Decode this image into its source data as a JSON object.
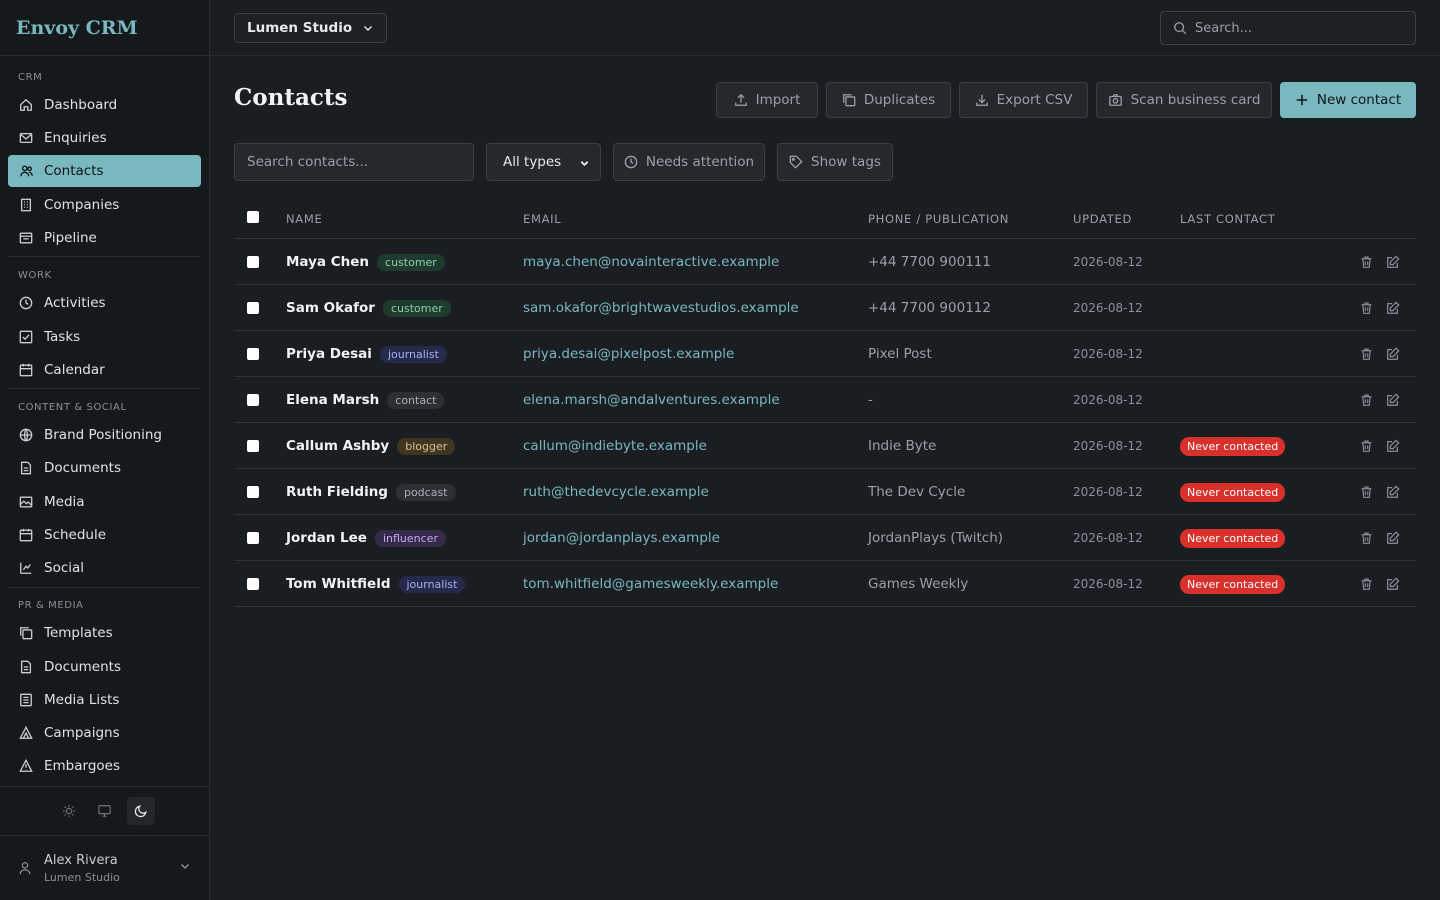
{
  "app": {
    "brand": "Envoy CRM"
  },
  "workspace": {
    "name": "Lumen Studio"
  },
  "top_search": {
    "placeholder": "Search..."
  },
  "sidebar": {
    "sections": [
      {
        "label": "CRM",
        "items": [
          {
            "label": "Dashboard",
            "icon": "home-icon"
          },
          {
            "label": "Enquiries",
            "icon": "mail-icon"
          },
          {
            "label": "Contacts",
            "icon": "users-icon",
            "active": true
          },
          {
            "label": "Companies",
            "icon": "building-icon"
          },
          {
            "label": "Pipeline",
            "icon": "pipeline-icon"
          }
        ]
      },
      {
        "label": "WORK",
        "items": [
          {
            "label": "Activities",
            "icon": "clock-icon"
          },
          {
            "label": "Tasks",
            "icon": "check-square-icon"
          },
          {
            "label": "Calendar",
            "icon": "calendar-icon"
          }
        ]
      },
      {
        "label": "CONTENT & SOCIAL",
        "items": [
          {
            "label": "Brand Positioning",
            "icon": "globe-icon"
          },
          {
            "label": "Documents",
            "icon": "document-icon"
          },
          {
            "label": "Media",
            "icon": "image-icon"
          },
          {
            "label": "Schedule",
            "icon": "calendar-icon"
          },
          {
            "label": "Social",
            "icon": "social-icon"
          }
        ]
      },
      {
        "label": "PR & MEDIA",
        "items": [
          {
            "label": "Templates",
            "icon": "copy-icon"
          },
          {
            "label": "Documents",
            "icon": "document-icon"
          },
          {
            "label": "Media Lists",
            "icon": "list-icon"
          },
          {
            "label": "Campaigns",
            "icon": "triangle-icon"
          },
          {
            "label": "Embargoes",
            "icon": "warning-icon"
          }
        ]
      }
    ],
    "theme": {
      "options": [
        "light",
        "system",
        "dark"
      ],
      "selected": "dark"
    },
    "user": {
      "name": "Alex Rivera",
      "org": "Lumen Studio"
    }
  },
  "main": {
    "title": "Contacts",
    "actions": {
      "import": "Import",
      "duplicates": "Duplicates",
      "export": "Export CSV",
      "scan": "Scan business card",
      "new_contact": "New contact"
    },
    "filters": {
      "search_placeholder": "Search contacts...",
      "type_selected": "All types",
      "needs_attention": "Needs attention",
      "show_tags": "Show tags"
    },
    "table": {
      "headers": {
        "name": "NAME",
        "email": "EMAIL",
        "phone": "PHONE / PUBLICATION",
        "updated": "UPDATED",
        "last_contact": "LAST CONTACT"
      },
      "rows": [
        {
          "name": "Maya Chen",
          "tag": "customer",
          "email": "maya.chen@novainteractive.example",
          "phone": "+44 7700 900111",
          "updated": "2026-08-12",
          "last_contact": ""
        },
        {
          "name": "Sam Okafor",
          "tag": "customer",
          "email": "sam.okafor@brightwavestudios.example",
          "phone": "+44 7700 900112",
          "updated": "2026-08-12",
          "last_contact": ""
        },
        {
          "name": "Priya Desai",
          "tag": "journalist",
          "email": "priya.desai@pixelpost.example",
          "phone": "Pixel Post",
          "updated": "2026-08-12",
          "last_contact": ""
        },
        {
          "name": "Elena Marsh",
          "tag": "contact",
          "email": "elena.marsh@andalventures.example",
          "phone": "-",
          "updated": "2026-08-12",
          "last_contact": ""
        },
        {
          "name": "Callum Ashby",
          "tag": "blogger",
          "email": "callum@indiebyte.example",
          "phone": "Indie Byte",
          "updated": "2026-08-12",
          "last_contact": "Never contacted"
        },
        {
          "name": "Ruth Fielding",
          "tag": "podcast",
          "email": "ruth@thedevcycle.example",
          "phone": "The Dev Cycle",
          "updated": "2026-08-12",
          "last_contact": "Never contacted"
        },
        {
          "name": "Jordan Lee",
          "tag": "influencer",
          "email": "jordan@jordanplays.example",
          "phone": "JordanPlays (Twitch)",
          "updated": "2026-08-12",
          "last_contact": "Never contacted"
        },
        {
          "name": "Tom Whitfield",
          "tag": "journalist",
          "email": "tom.whitfield@gamesweekly.example",
          "phone": "Games Weekly",
          "updated": "2026-08-12",
          "last_contact": "Never contacted"
        }
      ]
    }
  },
  "colors": {
    "accent": "#7ab8c0",
    "danger": "#d9302c",
    "background": "#1a1d21",
    "sidebar": "#16191c"
  }
}
